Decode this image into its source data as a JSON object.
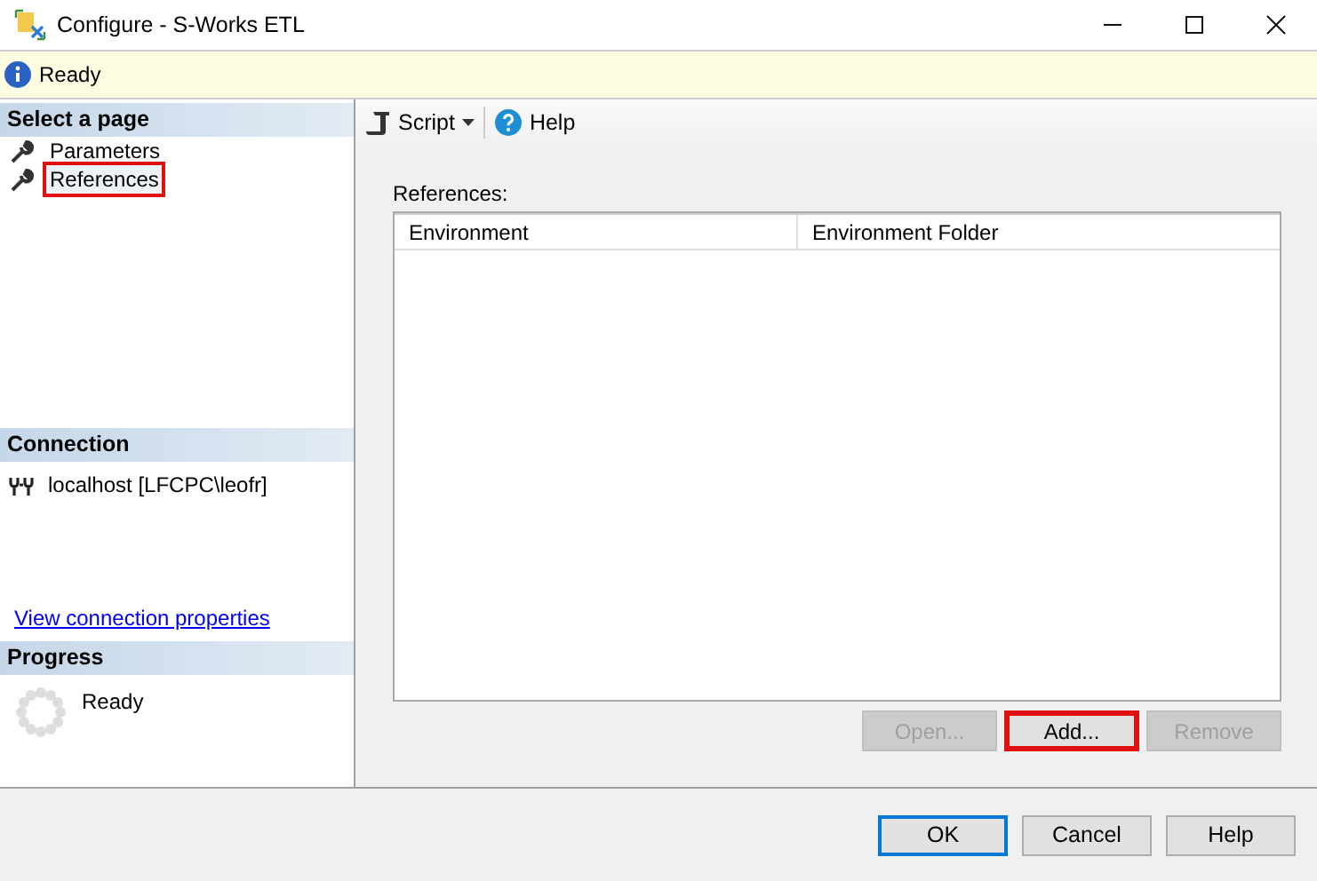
{
  "window": {
    "title": "Configure - S-Works ETL"
  },
  "status": {
    "text": "Ready"
  },
  "sidebar": {
    "pages_heading": "Select a page",
    "pages": [
      {
        "label": "Parameters",
        "selected": false,
        "highlighted": false
      },
      {
        "label": "References",
        "selected": true,
        "highlighted": true
      }
    ],
    "connection_heading": "Connection",
    "connection": "localhost [LFCPC\\leofr]",
    "connection_link": "View connection properties",
    "progress_heading": "Progress",
    "progress_status": "Ready"
  },
  "toolbar": [
    {
      "label": "Script",
      "kind": "script"
    },
    {
      "label": "Help",
      "kind": "help"
    }
  ],
  "references": {
    "label": "References:",
    "columns": [
      "Environment",
      "Environment Folder"
    ]
  },
  "grid_buttons": [
    {
      "label": "Open...",
      "disabled": true,
      "highlighted": false
    },
    {
      "label": "Add...",
      "disabled": false,
      "highlighted": true
    },
    {
      "label": "Remove",
      "disabled": true,
      "highlighted": false
    }
  ],
  "dialog_buttons": [
    {
      "label": "OK",
      "default": true
    },
    {
      "label": "Cancel",
      "default": false
    },
    {
      "label": "Help",
      "default": false
    }
  ]
}
